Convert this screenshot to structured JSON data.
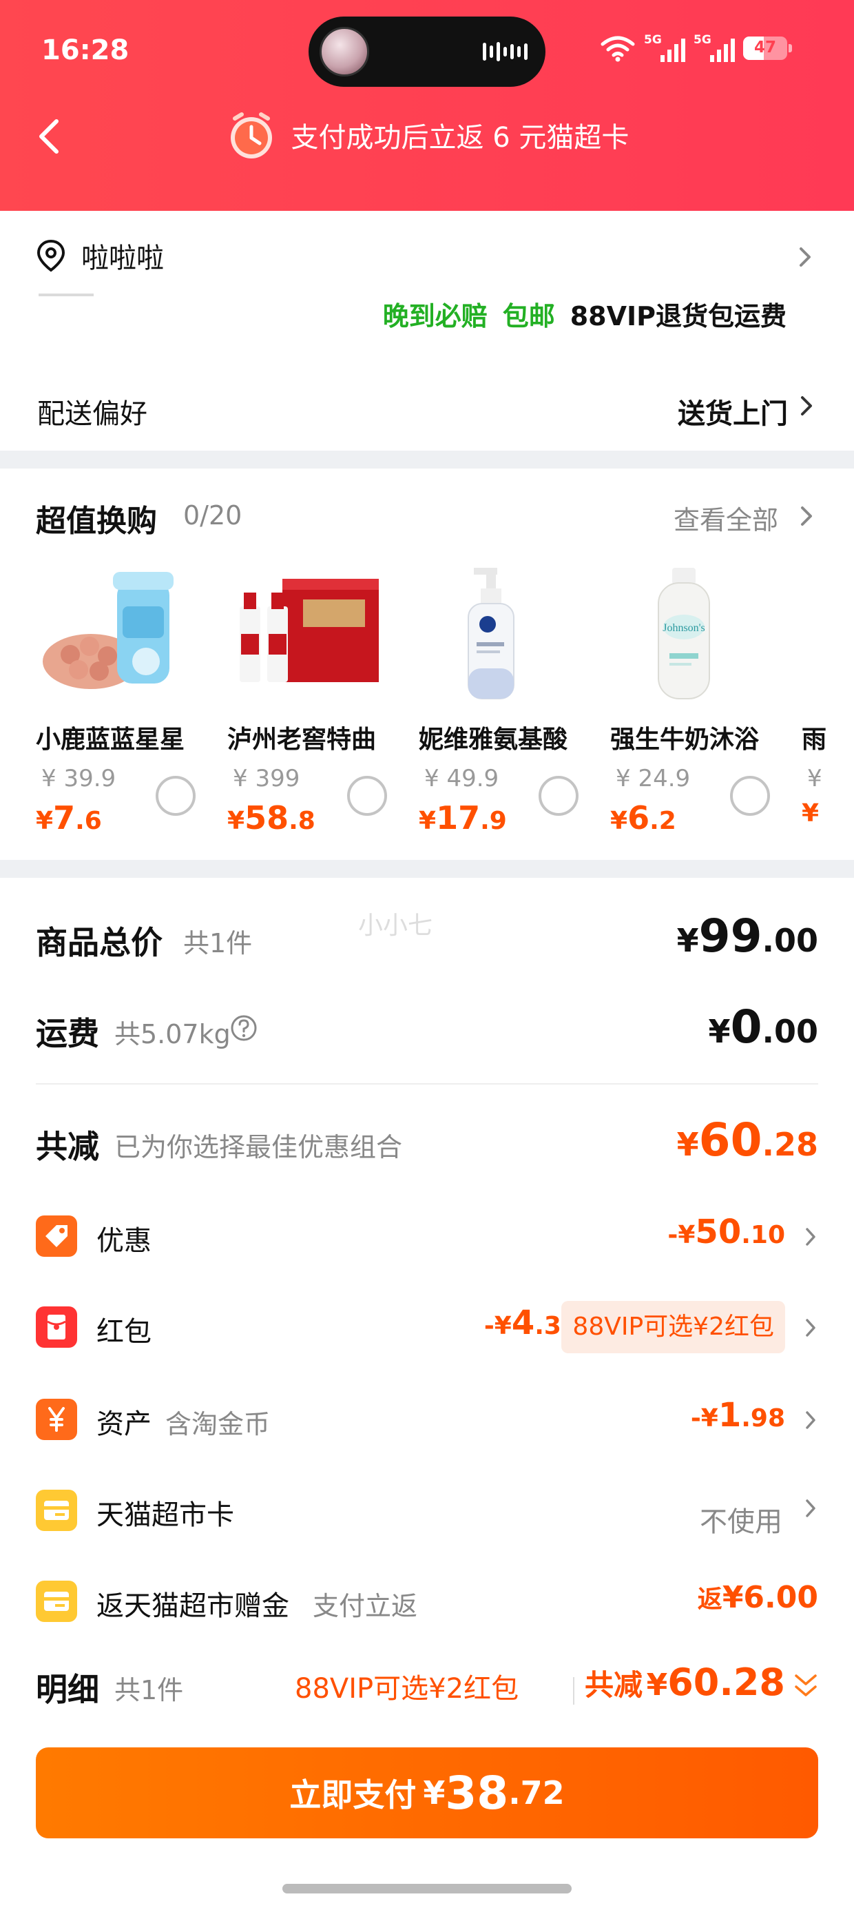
{
  "status_bar": {
    "time": "16:28",
    "signal1": "5G",
    "signal2": "5G",
    "battery": "47",
    "battery_level": 0.47
  },
  "header": {
    "promo_text": "支付成功后立返 6 元猫超卡"
  },
  "address": {
    "name": "啦啦啦",
    "tags": [
      "晚到必赔",
      "包邮",
      "88VIP退货包运费"
    ],
    "delivery_label": "配送偏好",
    "delivery_value": "送货上门"
  },
  "exchange": {
    "title": "超值换购",
    "count": "0/20",
    "view_all": "查看全部",
    "products": [
      {
        "name": "小鹿蓝蓝星星",
        "orig": "¥ 39.9",
        "cur": "¥",
        "int": "7",
        "dec": ".6"
      },
      {
        "name": "泸州老窖特曲",
        "orig": "¥ 399",
        "cur": "¥",
        "int": "58",
        "dec": ".8"
      },
      {
        "name": "妮维雅氨基酸",
        "orig": "¥ 49.9",
        "cur": "¥",
        "int": "17",
        "dec": ".9"
      },
      {
        "name": "强生牛奶沐浴",
        "orig": "¥ 24.9",
        "cur": "¥",
        "int": "6",
        "dec": ".2"
      },
      {
        "name": "雨",
        "orig": "¥",
        "cur": "¥",
        "int": "",
        "dec": ""
      }
    ]
  },
  "summary": {
    "watermark": "小小七",
    "total_label": "商品总价",
    "total_sub": "共1件",
    "total_cur": "¥",
    "total_int": "99",
    "total_dec": ".00",
    "ship_label": "运费",
    "ship_sub": "共5.07kg",
    "ship_cur": "¥",
    "ship_int": "0",
    "ship_dec": ".00",
    "reduce_label": "共减",
    "reduce_sub": "已为你选择最佳优惠组合",
    "reduce_cur": "¥",
    "reduce_int": "60",
    "reduce_dec": ".28",
    "lines": {
      "discount": {
        "label": "优惠",
        "prefix": "-¥",
        "int": "50",
        "dec": ".10"
      },
      "redpacket": {
        "label": "红包",
        "prefix": "-¥",
        "int": "4",
        "dec": ".30",
        "pill": "88VIP可选¥2红包"
      },
      "assets": {
        "label": "资产",
        "sub": "含淘金币",
        "prefix": "-¥",
        "int": "1",
        "dec": ".98"
      },
      "card": {
        "label": "天猫超市卡",
        "value": "不使用"
      },
      "gift": {
        "label": "返天猫超市赠金",
        "sub": "支付立返",
        "prefix": "返",
        "amount": "¥6.00"
      }
    },
    "detail": {
      "label": "明细",
      "count": "共1件",
      "vip": "88VIP可选¥2红包",
      "total_label": "共减",
      "total_cur": "¥",
      "total_num": "60.28"
    },
    "pay": {
      "label": "立即支付",
      "cur": "¥",
      "int": "38",
      "dec": ".72"
    }
  },
  "colors": {
    "header_red": "#ff4050",
    "accent_orange": "#ff5000",
    "green_tag": "#23b024"
  }
}
